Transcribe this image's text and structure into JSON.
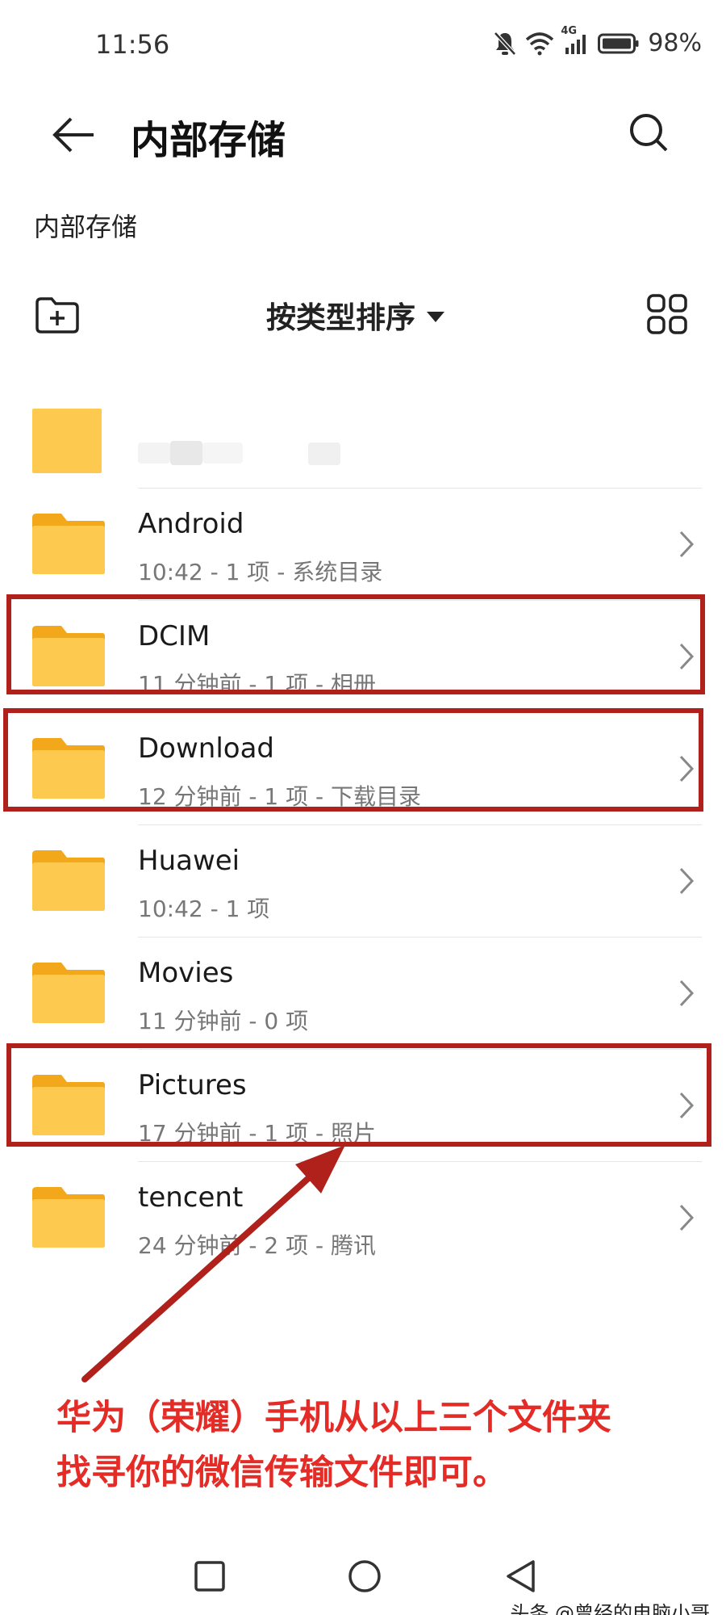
{
  "status_bar": {
    "time": "11:56",
    "network": "4G",
    "battery": "98%",
    "icons": [
      "bell-muted-icon",
      "wifi-icon",
      "signal-icon",
      "battery-icon"
    ]
  },
  "header": {
    "title": "内部存储",
    "back_icon": "arrow-left-icon",
    "search_icon": "search-icon"
  },
  "breadcrumb": "内部存储",
  "toolbar": {
    "sort_label": "按类型排序",
    "new_folder_icon": "folder-add-icon",
    "view_icon": "grid-view-icon"
  },
  "folders": [
    {
      "name": "Android",
      "meta": "10:42 - 1 项 - 系统目录"
    },
    {
      "name": "DCIM",
      "meta": "11 分钟前 - 1 项 - 相册"
    },
    {
      "name": "Download",
      "meta": "12 分钟前 - 1 项 - 下载目录"
    },
    {
      "name": "Huawei",
      "meta": "10:42 - 1 项"
    },
    {
      "name": "Movies",
      "meta": "11 分钟前 - 0 项"
    },
    {
      "name": "Pictures",
      "meta": "17 分钟前 - 1 项 - 照片"
    },
    {
      "name": "tencent",
      "meta": "24 分钟前 - 2 项 - 腾讯"
    }
  ],
  "annotation": {
    "line1": "华为（荣耀）手机从以上三个文件夹",
    "line2": "找寻你的微信传输文件即可。",
    "color": "#e52b26",
    "box_color": "#b0211c"
  },
  "colors": {
    "folder_body": "#fdc94f",
    "folder_tab": "#f3a71b"
  },
  "nav_bar": {
    "icons": [
      "recent-apps-icon",
      "home-icon",
      "back-triangle-icon"
    ]
  },
  "watermark": "头条 @曾经的电脑小哥"
}
